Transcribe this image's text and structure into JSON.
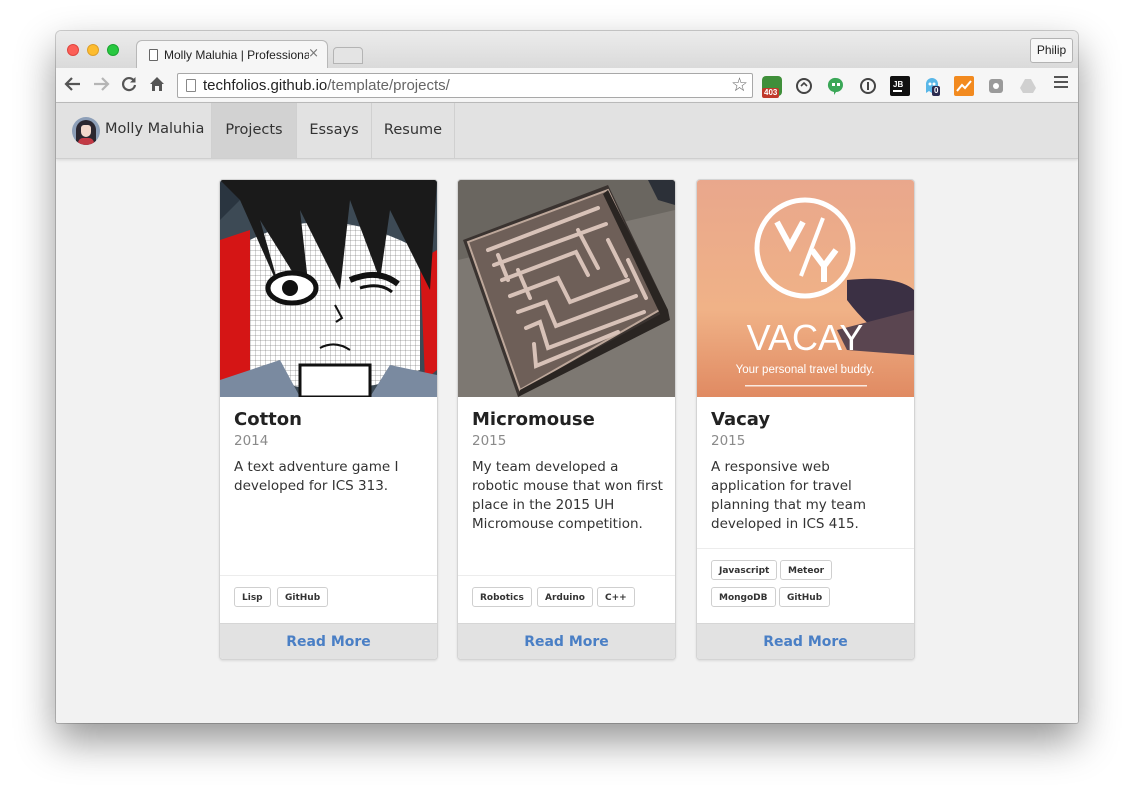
{
  "browser": {
    "tab_title": "Molly Maluhia | Professional Portfolio",
    "tab_close": "×",
    "profile_name": "Philip",
    "url_host": "techfolios.github.io",
    "url_path": "/template/projects/",
    "extension_badges": [
      "403",
      "0"
    ]
  },
  "site": {
    "owner_name": "Molly Maluhia",
    "nav": [
      "Projects",
      "Essays",
      "Resume"
    ],
    "active_nav": "Projects"
  },
  "cards": [
    {
      "title": "Cotton",
      "year": "2014",
      "description": "A text adventure game I developed for ICS 313.",
      "tags": [
        "Lisp",
        "GitHub"
      ],
      "link": "Read More"
    },
    {
      "title": "Micromouse",
      "year": "2015",
      "description": "My team developed a robotic mouse that won first place in the 2015 UH Micromouse competition.",
      "tags": [
        "Robotics",
        "Arduino",
        "C++"
      ],
      "link": "Read More"
    },
    {
      "title": "Vacay",
      "year": "2015",
      "description": "A responsive web application for travel planning that my team developed in ICS 415.",
      "tags": [
        "Javascript",
        "Meteor",
        "MongoDB",
        "GitHub"
      ],
      "link": "Read More",
      "image_logo_text": "VACAY",
      "image_tagline": "Your personal travel buddy."
    }
  ],
  "colors": {
    "link_blue": "#4a7fc5",
    "nav_bg": "#e2e2e2",
    "page_bg": "#f2f2f2"
  }
}
